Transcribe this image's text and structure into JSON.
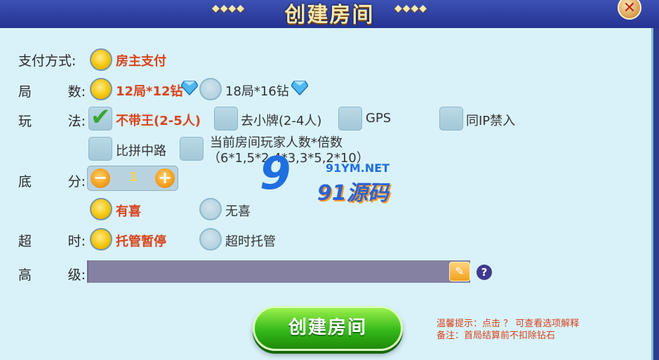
{
  "header": {
    "title": "创建房间",
    "deco_left": "◆◆◆◆",
    "deco_right": "◆◆◆◆",
    "close_symbol": "✕"
  },
  "rows": {
    "payment": {
      "label": "支付方式:",
      "options": [
        {
          "text": "房主支付",
          "selected": true
        }
      ]
    },
    "rounds": {
      "label_a": "局",
      "label_b": "数:",
      "options": [
        {
          "text": "12局*12钻",
          "selected": true
        },
        {
          "text": "18局*16钻",
          "selected": false
        }
      ]
    },
    "rules": {
      "label_a": "玩",
      "label_b": "法:",
      "options": [
        {
          "text": "不带王(2-5人)",
          "checked": true
        },
        {
          "text": "去小牌(2-4人)",
          "checked": false
        },
        {
          "text": "GPS",
          "checked": false
        },
        {
          "text": "同IP禁入",
          "checked": false
        },
        {
          "text": "比拼中路",
          "checked": false
        },
        {
          "text": "当前房间玩家人数*倍数",
          "checked": false
        }
      ],
      "multiplier_note": "（6*1,5*2,4*3,3*5,2*10）"
    },
    "base_score": {
      "label_a": "底",
      "label_b": "分:",
      "value": "1",
      "minus": "−",
      "plus": "+"
    },
    "bonus": {
      "options": [
        {
          "text": "有喜",
          "selected": true
        },
        {
          "text": "无喜",
          "selected": false
        }
      ]
    },
    "timeout": {
      "label_a": "超",
      "label_b": "时:",
      "options": [
        {
          "text": "托管暂停",
          "selected": true
        },
        {
          "text": "超时托管",
          "selected": false
        }
      ]
    },
    "advanced": {
      "label_a": "高",
      "label_b": "级:",
      "help": "?"
    }
  },
  "create_button": "创建房间",
  "hints": {
    "line1": "温馨提示：点击 ？ 可查看选项解释",
    "line2": "备注：首局结算前不扣除钻石"
  },
  "watermark": {
    "digit": "9",
    "url": "91YM.NET",
    "name": "91源码"
  },
  "colors": {
    "accent_orange": "#d8431b",
    "radio_on": "#f2c300",
    "create_green": "#35b91a"
  }
}
